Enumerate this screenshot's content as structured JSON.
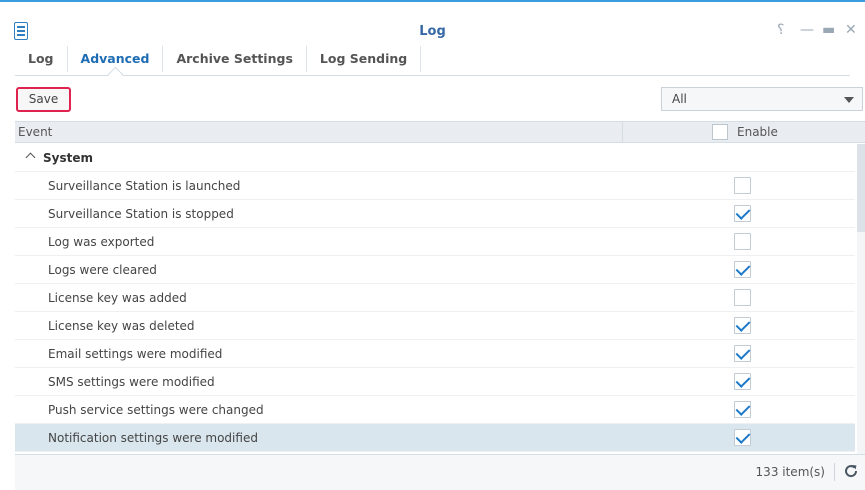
{
  "window": {
    "title": "Log"
  },
  "tabs": [
    {
      "label": "Log",
      "active": false
    },
    {
      "label": "Advanced",
      "active": true
    },
    {
      "label": "Archive Settings",
      "active": false
    },
    {
      "label": "Log Sending",
      "active": false
    }
  ],
  "toolbar": {
    "save_label": "Save",
    "filter_value": "All"
  },
  "grid": {
    "columns": {
      "event": "Event",
      "enable": "Enable"
    },
    "group": {
      "label": "System",
      "expanded": true
    },
    "rows": [
      {
        "label": "Surveillance Station is launched",
        "enabled": false
      },
      {
        "label": "Surveillance Station is stopped",
        "enabled": true
      },
      {
        "label": "Log was exported",
        "enabled": false
      },
      {
        "label": "Logs were cleared",
        "enabled": true
      },
      {
        "label": "License key was added",
        "enabled": false
      },
      {
        "label": "License key was deleted",
        "enabled": true
      },
      {
        "label": "Email settings were modified",
        "enabled": true
      },
      {
        "label": "SMS settings were modified",
        "enabled": true
      },
      {
        "label": "Push service settings were changed",
        "enabled": true
      },
      {
        "label": "Notification settings were modified",
        "enabled": true,
        "selected": true
      }
    ]
  },
  "footer": {
    "item_count": "133 item(s)"
  },
  "colors": {
    "accent": "#1e6cb3",
    "highlight_border": "#e0224e",
    "selected_row": "#d9e6ee"
  }
}
